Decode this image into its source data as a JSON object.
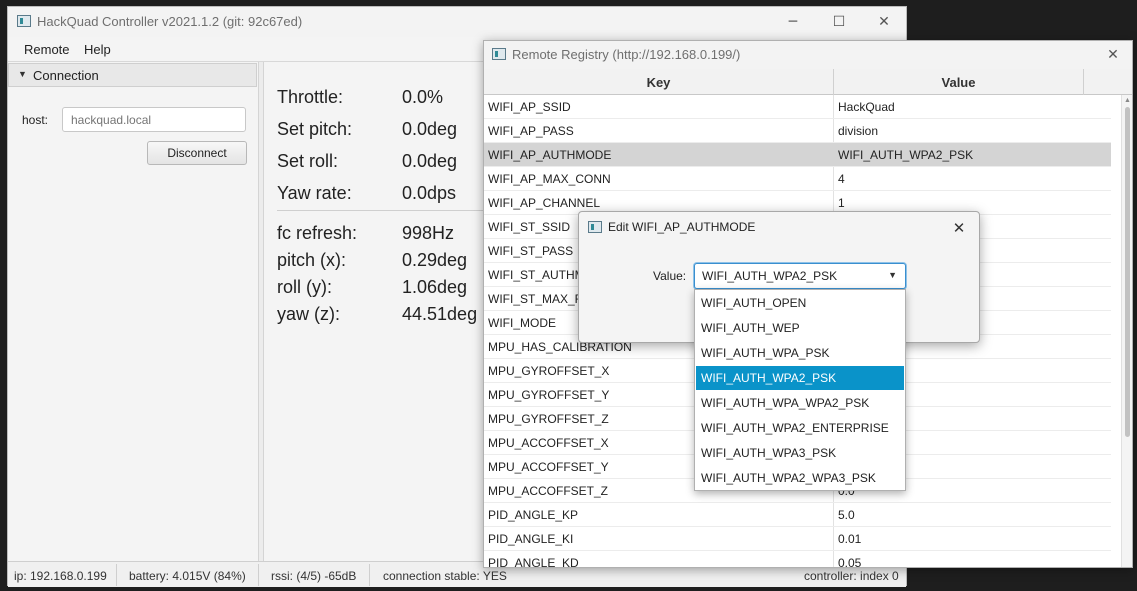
{
  "main_window": {
    "title": "HackQuad Controller v2021.1.2 (git: 92c67ed)",
    "controls": {
      "minimize": "─",
      "maximize": "☐",
      "close": "✕"
    },
    "menu": [
      "Remote",
      "Help"
    ]
  },
  "connection": {
    "section_title": "Connection",
    "host_label": "host:",
    "host_placeholder": "hackquad.local",
    "disconnect_label": "Disconnect"
  },
  "telemetry": {
    "setpoints": [
      {
        "label": "Throttle:",
        "value": "0.0%"
      },
      {
        "label": "Set pitch:",
        "value": "0.0deg"
      },
      {
        "label": "Set roll:",
        "value": "0.0deg"
      },
      {
        "label": "Yaw rate:",
        "value": "0.0dps"
      }
    ],
    "readings": [
      {
        "label": "fc refresh:",
        "value": "998Hz"
      },
      {
        "label": "pitch (x):",
        "value": "0.29deg"
      },
      {
        "label": "roll (y):",
        "value": "1.06deg"
      },
      {
        "label": "yaw (z):",
        "value": "44.51deg"
      }
    ]
  },
  "status_bar": {
    "ip": "ip: 192.168.0.199",
    "battery": "battery: 4.015V (84%)",
    "rssi": "rssi: (4/5) -65dB",
    "connection": "connection stable: YES",
    "controller": "controller: index 0"
  },
  "registry": {
    "title": "Remote Registry (http://192.168.0.199/)",
    "close": "✕",
    "columns": [
      "Key",
      "Value"
    ],
    "rows": [
      {
        "key": "WIFI_AP_SSID",
        "value": "HackQuad"
      },
      {
        "key": "WIFI_AP_PASS",
        "value": "division"
      },
      {
        "key": "WIFI_AP_AUTHMODE",
        "value": "WIFI_AUTH_WPA2_PSK"
      },
      {
        "key": "WIFI_AP_MAX_CONN",
        "value": "4"
      },
      {
        "key": "WIFI_AP_CHANNEL",
        "value": "1"
      },
      {
        "key": "WIFI_ST_SSID",
        "value": ""
      },
      {
        "key": "WIFI_ST_PASS",
        "value": ""
      },
      {
        "key": "WIFI_ST_AUTHMODE",
        "value": ""
      },
      {
        "key": "WIFI_ST_MAX_RETRY",
        "value": ""
      },
      {
        "key": "WIFI_MODE",
        "value": ""
      },
      {
        "key": "MPU_HAS_CALIBRATION",
        "value": ""
      },
      {
        "key": "MPU_GYROFFSET_X",
        "value": ""
      },
      {
        "key": "MPU_GYROFFSET_Y",
        "value": ""
      },
      {
        "key": "MPU_GYROFFSET_Z",
        "value": ""
      },
      {
        "key": "MPU_ACCOFFSET_X",
        "value": ""
      },
      {
        "key": "MPU_ACCOFFSET_Y",
        "value": ""
      },
      {
        "key": "MPU_ACCOFFSET_Z",
        "value": "0.0"
      },
      {
        "key": "PID_ANGLE_KP",
        "value": "5.0"
      },
      {
        "key": "PID_ANGLE_KI",
        "value": "0.01"
      },
      {
        "key": "PID_ANGLE_KD",
        "value": "0.05"
      }
    ],
    "selected_row": 2
  },
  "edit_dialog": {
    "title": "Edit WIFI_AP_AUTHMODE",
    "close": "✕",
    "value_label": "Value:",
    "selected_value": "WIFI_AUTH_WPA2_PSK",
    "options": [
      "WIFI_AUTH_OPEN",
      "WIFI_AUTH_WEP",
      "WIFI_AUTH_WPA_PSK",
      "WIFI_AUTH_WPA2_PSK",
      "WIFI_AUTH_WPA_WPA2_PSK",
      "WIFI_AUTH_WPA2_ENTERPRISE",
      "WIFI_AUTH_WPA3_PSK",
      "WIFI_AUTH_WPA2_WPA3_PSK"
    ],
    "highlighted_option": 3
  },
  "colors": {
    "selection_accent": "#0a93c9",
    "focus_border": "#3a8fcf",
    "row_selected": "#d4d4d4"
  }
}
